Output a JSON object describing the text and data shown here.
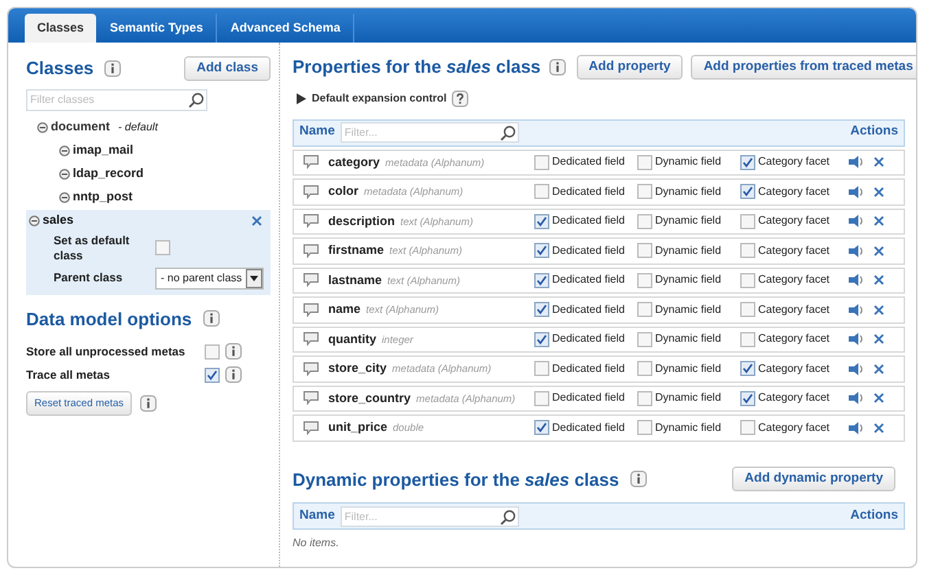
{
  "tabs": [
    {
      "label": "Classes",
      "selected": true
    },
    {
      "label": "Semantic Types",
      "selected": false
    },
    {
      "label": "Advanced Schema",
      "selected": false
    }
  ],
  "classes_panel": {
    "title": "Classes",
    "add_button": "Add class",
    "filter_placeholder": "Filter classes",
    "tree": [
      {
        "name": "document",
        "note": "- default",
        "selected": false,
        "children": [
          {
            "name": "imap_mail",
            "selected": false
          },
          {
            "name": "ldap_record",
            "selected": false
          },
          {
            "name": "nntp_post",
            "selected": false
          }
        ]
      },
      {
        "name": "sales",
        "selected": true,
        "default_label": "Set as default class",
        "default_checked": false,
        "parent_label": "Parent class",
        "parent_value": "- no parent class"
      }
    ]
  },
  "options_panel": {
    "title": "Data model options",
    "options": [
      {
        "label": "Store all unprocessed metas",
        "checked": false
      },
      {
        "label": "Trace all metas",
        "checked": true
      }
    ],
    "reset_button": "Reset traced metas"
  },
  "properties": {
    "title": "Properties for the *sales* class",
    "add_button": "Add property",
    "traced_button": "Add properties from traced metas",
    "expansion_label": "Default expansion control",
    "name_header": "Name",
    "filter_placeholder": "Filter...",
    "actions_header": "Actions",
    "rows": [
      {
        "name": "category",
        "type": "metadata (Alphanum)",
        "fields": [
          {
            "label": "Dedicated field",
            "checked": false
          },
          {
            "label": "Dynamic field",
            "checked": false
          },
          {
            "label": "Category facet",
            "checked": true
          }
        ]
      },
      {
        "name": "color",
        "type": "metadata (Alphanum)",
        "fields": [
          {
            "label": "Dedicated field",
            "checked": false
          },
          {
            "label": "Dynamic field",
            "checked": false
          },
          {
            "label": "Category facet",
            "checked": true
          }
        ]
      },
      {
        "name": "description",
        "type": "text (Alphanum)",
        "fields": [
          {
            "label": "Dedicated field",
            "checked": true
          },
          {
            "label": "Dynamic field",
            "checked": false
          },
          {
            "label": "Category facet",
            "checked": false
          }
        ]
      },
      {
        "name": "firstname",
        "type": "text (Alphanum)",
        "fields": [
          {
            "label": "Dedicated field",
            "checked": true
          },
          {
            "label": "Dynamic field",
            "checked": false
          },
          {
            "label": "Category facet",
            "checked": false
          }
        ]
      },
      {
        "name": "lastname",
        "type": "text (Alphanum)",
        "fields": [
          {
            "label": "Dedicated field",
            "checked": true
          },
          {
            "label": "Dynamic field",
            "checked": false
          },
          {
            "label": "Category facet",
            "checked": false
          }
        ]
      },
      {
        "name": "name",
        "type": "text (Alphanum)",
        "fields": [
          {
            "label": "Dedicated field",
            "checked": true
          },
          {
            "label": "Dynamic field",
            "checked": false
          },
          {
            "label": "Category facet",
            "checked": false
          }
        ]
      },
      {
        "name": "quantity",
        "type": "integer",
        "fields": [
          {
            "label": "Dedicated field",
            "checked": true
          },
          {
            "label": "Dynamic field",
            "checked": false
          },
          {
            "label": "Category facet",
            "checked": false
          }
        ]
      },
      {
        "name": "store_city",
        "type": "metadata (Alphanum)",
        "fields": [
          {
            "label": "Dedicated field",
            "checked": false
          },
          {
            "label": "Dynamic field",
            "checked": false
          },
          {
            "label": "Category facet",
            "checked": true
          }
        ]
      },
      {
        "name": "store_country",
        "type": "metadata (Alphanum)",
        "fields": [
          {
            "label": "Dedicated field",
            "checked": false
          },
          {
            "label": "Dynamic field",
            "checked": false
          },
          {
            "label": "Category facet",
            "checked": true
          }
        ]
      },
      {
        "name": "unit_price",
        "type": "double",
        "fields": [
          {
            "label": "Dedicated field",
            "checked": true
          },
          {
            "label": "Dynamic field",
            "checked": false
          },
          {
            "label": "Category facet",
            "checked": false
          }
        ]
      }
    ]
  },
  "dynamic_properties": {
    "title": "Dynamic properties for the *sales* class",
    "add_button": "Add dynamic property",
    "name_header": "Name",
    "filter_placeholder": "Filter...",
    "actions_header": "Actions",
    "empty_text": "No items."
  }
}
